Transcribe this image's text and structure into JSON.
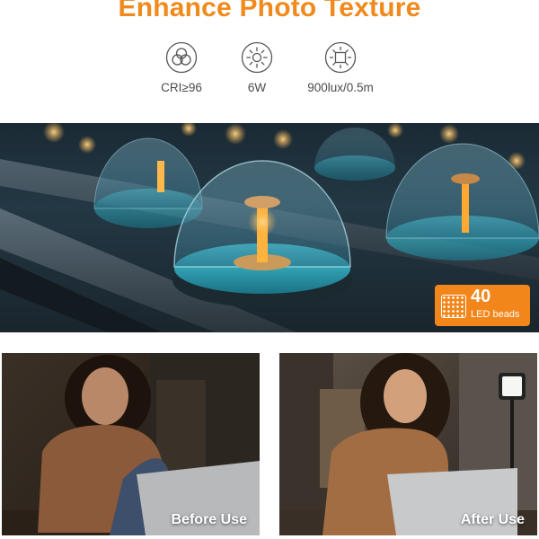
{
  "header": {
    "title": "Enhance Photo Texture"
  },
  "specs": [
    {
      "icon": "color-circles-icon",
      "label": "CRI≥96"
    },
    {
      "icon": "sun-icon",
      "label": "6W"
    },
    {
      "icon": "brightness-square-icon",
      "label": "900lux/0.5m"
    }
  ],
  "hero": {
    "badge": {
      "number": "40",
      "text": "LED beads"
    }
  },
  "comparison": {
    "before": "Before Use",
    "after": "After Use"
  },
  "colors": {
    "accent": "#f2861b",
    "title": "#f08a1c"
  }
}
